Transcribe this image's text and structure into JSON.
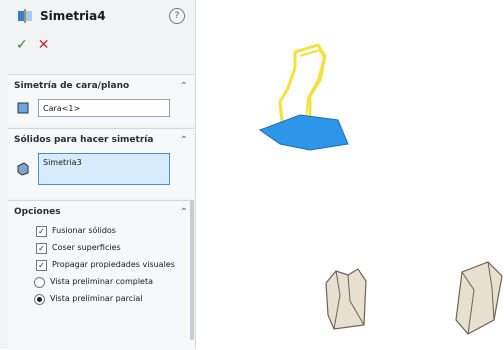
{
  "panel": {
    "title": "Simetria4",
    "help_icon": "?",
    "ok": "✓",
    "cancel": "✕"
  },
  "sections": {
    "face_plane": {
      "title": "Simetría de cara/plano",
      "value": "Cara<1>"
    },
    "bodies": {
      "title": "Sólidos para hacer simetría",
      "value": "Simetria3"
    },
    "options": {
      "title": "Opciones",
      "items": [
        {
          "label": "Fusionar sólidos",
          "checked": true
        },
        {
          "label": "Coser superficies",
          "checked": true
        },
        {
          "label": "Propagar propiedades visuales",
          "checked": true
        }
      ],
      "radios": [
        {
          "label": "Vista preliminar completa",
          "selected": false
        },
        {
          "label": "Vista preliminar parcial",
          "selected": true
        }
      ]
    }
  },
  "colors": {
    "selection": "#2d96e8",
    "highlight": "#f4e23b",
    "part": "#e7dfcf"
  }
}
